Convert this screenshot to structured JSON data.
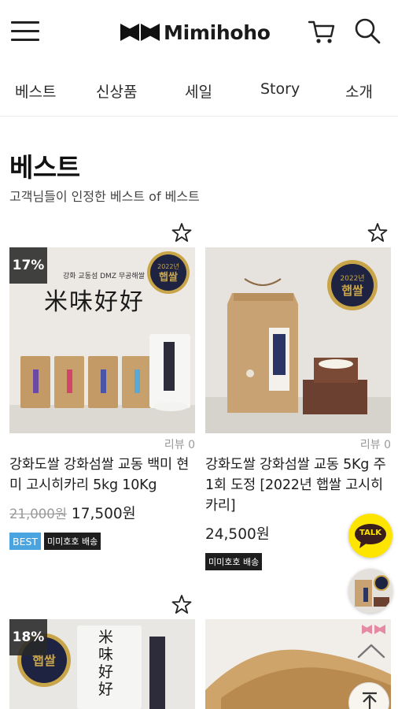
{
  "header": {
    "brand": "Mimihoho",
    "icons": [
      "hamburger-menu-icon",
      "cart-icon",
      "search-icon"
    ]
  },
  "nav": {
    "tabs": [
      {
        "label": "베스트"
      },
      {
        "label": "신상품"
      },
      {
        "label": "세일"
      },
      {
        "label": "Story"
      },
      {
        "label": "소개"
      }
    ]
  },
  "section": {
    "title": "베스트",
    "subtitle": "고객님들이 인정한 베스트 of 베스트"
  },
  "products": [
    {
      "discount": "17%",
      "review": "리뷰 0",
      "name": "강화도쌀 강화섬쌀 교동 백미 현미 고시히카리 5kg 10Kg",
      "original_price": "21,000원",
      "price": "17,500원",
      "badges": [
        "BEST",
        "미미호호 배송"
      ],
      "image_text": {
        "brand_line": "강화 교동섬 DMZ 무공해쌀",
        "calligraphy": "米味好好",
        "seal": "2022년 햅쌀"
      }
    },
    {
      "review": "리뷰 0",
      "name": "강화도쌀 강화섬쌀 교동 5Kg 주1회 도정 [2022년 햅쌀 고시히카리]",
      "price": "24,500원",
      "badges": [
        "미미호호 배송"
      ],
      "image_text": {
        "seal": "2022년 햅쌀"
      }
    },
    {
      "discount": "18%",
      "image_text": {
        "seal": "햅쌀",
        "calligraphy": "米味好好"
      }
    },
    {
      "image_text": {}
    }
  ],
  "floating": {
    "kakao_label": "TALK",
    "icons": [
      "kakao-talk-icon",
      "recent-view-thumbnail",
      "scroll-up-arrow-icon",
      "top-button-icon"
    ]
  },
  "colors": {
    "best_badge": "#4aa4df",
    "ship_badge": "#1e1e1e",
    "kakao": "#fee500",
    "seal": "#1d2340",
    "seal_gold": "#c9a54a",
    "logo_pink": "#e48aa2"
  }
}
